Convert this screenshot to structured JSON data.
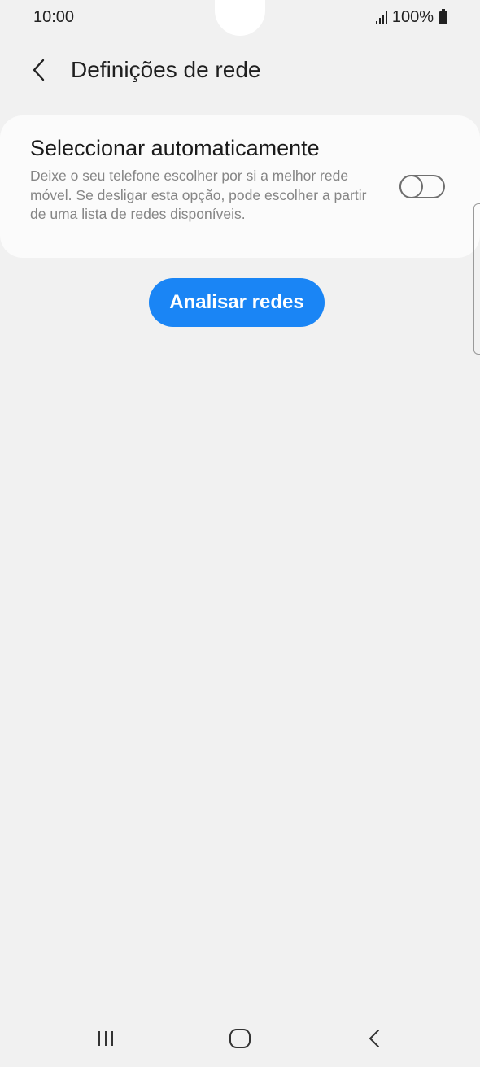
{
  "status_bar": {
    "time": "10:00",
    "battery": "100%",
    "icons": [
      "signal-icon",
      "battery-icon"
    ]
  },
  "header": {
    "title": "Definições de rede",
    "back_icon": "chevron-left-icon"
  },
  "network_selection": {
    "title": "Seleccionar automaticamente",
    "description": "Deixe o seu telefone escolher por si a melhor rede móvel. Se desligar esta opção, pode escolher a partir de uma lista de redes disponíveis.",
    "toggle_state": "off"
  },
  "scan_button": {
    "label": "Analisar redes"
  },
  "nav_bar": {
    "icons": [
      "recents-icon",
      "home-icon",
      "back-icon"
    ]
  },
  "colors": {
    "accent": "#1a85f5",
    "background": "#f1f1f1",
    "card": "#fbfbfb",
    "description_text": "#858585"
  }
}
